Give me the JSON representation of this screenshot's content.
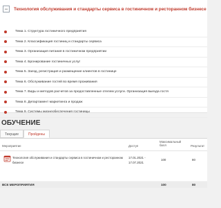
{
  "course": {
    "toggle_symbol": "−",
    "title": "Технология обслуживания и стандарты сервиса в гостиничном и ресторанном бизнесе",
    "topics": [
      "Тема 1. Структура гостиничного предприятия",
      "Тема 2. Классификация гостиниц и стандарты сервиса",
      "Тема 3. Организация питания в гостиничном предприятии",
      "Тема 4. Бронирование гостиничных услуг",
      "Тема 5. Заезд, регистрация и размещение клиентов в гостинице",
      "Тема 6. Обслуживание гостей во время проживания",
      "Тема 7. Виды и методов расчетов за предоставленные отелем услуги. Организация выезда гостя",
      "Тема 8. Департамент маркетинга и продаж",
      "Тема 9. Системы жизнеобеспечения гостиницы"
    ]
  },
  "learning": {
    "section_title": "ОБУЧЕНИЕ",
    "tabs": [
      {
        "label": "Текущие",
        "active": false
      },
      {
        "label": "Пройдены",
        "active": true
      }
    ],
    "table": {
      "headers": {
        "activity": "Мероприятие",
        "access": "Доступ",
        "max_score_line1": "Максимальный",
        "max_score_line2": "балл",
        "result": "Результат"
      },
      "rows": [
        {
          "icon": "course-book-icon",
          "name": "Технология обслуживания и стандарты сервиса в гостиничном и ресторанном бизнесе",
          "access_from": "17.01.2021 -",
          "access_to": "17.07.2021",
          "max_score": "100",
          "result": "80"
        }
      ],
      "total": {
        "label": "ВСЕ МЕРОПРИЯТИЯ",
        "max_score": "100",
        "result": "80"
      }
    }
  },
  "colors": {
    "accent": "#c0392b",
    "background": "#f1f1f1",
    "panel": "#ffffff"
  }
}
